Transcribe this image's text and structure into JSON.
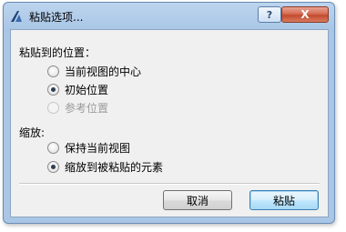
{
  "window": {
    "title": "粘贴选项...",
    "help_label": "?",
    "close_label": "X"
  },
  "position_group": {
    "label": "粘贴到的位置：",
    "options": [
      {
        "label": "当前视图的中心",
        "checked": false,
        "disabled": false
      },
      {
        "label": "初始位置",
        "checked": true,
        "disabled": false
      },
      {
        "label": "参考位置",
        "checked": false,
        "disabled": true
      }
    ]
  },
  "scale_group": {
    "label": "缩放:",
    "options": [
      {
        "label": "保持当前视图",
        "checked": false,
        "disabled": false
      },
      {
        "label": "缩放到被粘贴的元素",
        "checked": true,
        "disabled": false
      }
    ]
  },
  "buttons": {
    "cancel_label": "取消",
    "paste_label": "粘贴"
  },
  "colors": {
    "title_bar": "#bcd4ee",
    "close_button": "#c24b2d",
    "dialog_body": "#f0f0f0",
    "primary_button": "#bee6fd"
  }
}
